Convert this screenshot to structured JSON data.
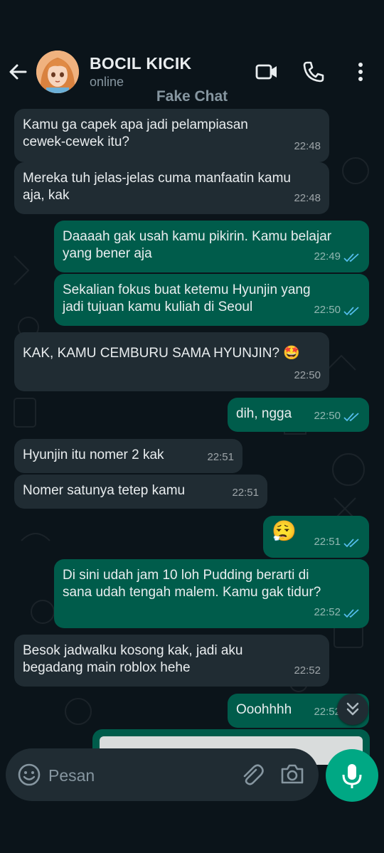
{
  "contact": {
    "name": "BOCIL KICIK",
    "status": "online"
  },
  "watermark": "Fake Chat",
  "messages": [
    {
      "dir": "in",
      "text": "Kamu ga capek apa jadi pelampiasan\ncewek-cewek itu?",
      "time": "22:48"
    },
    {
      "dir": "in",
      "text": "Mereka tuh jelas-jelas cuma manfaatin kamu\naja, kak",
      "time": "22:48"
    },
    {
      "dir": "out",
      "text": "Daaaah gak usah kamu pikirin. Kamu belajar\nyang bener aja",
      "time": "22:49",
      "status": "read"
    },
    {
      "dir": "out",
      "text": "Sekalian fokus buat ketemu Hyunjin yang\njadi tujuan kamu kuliah di Seoul",
      "time": "22:50",
      "status": "read"
    },
    {
      "dir": "in",
      "text": "KAK, KAMU CEMBURU SAMA HYUNJIN? 🤩",
      "time": "22:50"
    },
    {
      "dir": "out",
      "text": "dih, ngga",
      "time": "22:50",
      "status": "read"
    },
    {
      "dir": "in",
      "text": "Hyunjin itu nomer 2 kak",
      "time": "22:51"
    },
    {
      "dir": "in",
      "text": "Nomer satunya tetep kamu",
      "time": "22:51"
    },
    {
      "dir": "out",
      "text": "😮‍💨",
      "time": "22:51",
      "status": "read"
    },
    {
      "dir": "out",
      "text": "Di sini udah jam 10 loh Pudding berarti di\nsana udah tengah malem. Kamu gak tidur?",
      "time": "22:52",
      "status": "read"
    },
    {
      "dir": "in",
      "text": "Besok jadwalku kosong kak, jadi aku\nbegadang main roblox hehe",
      "time": "22:52"
    },
    {
      "dir": "out",
      "text": "Ooohhhh",
      "time": "22:52",
      "status": "read"
    }
  ],
  "composer": {
    "placeholder": "Pesan"
  },
  "colors": {
    "background": "#0b141a",
    "incoming": "#202c33",
    "outgoing": "#005c4b",
    "accent": "#00a884",
    "read_ticks": "#53bdeb"
  },
  "icons": [
    "back-arrow-icon",
    "video-call-icon",
    "voice-call-icon",
    "menu-dots-icon",
    "scroll-down-icon",
    "emoji-icon",
    "attach-icon",
    "camera-icon",
    "mic-icon"
  ]
}
